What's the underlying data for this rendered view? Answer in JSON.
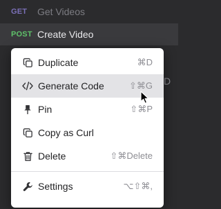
{
  "requests": [
    {
      "method": "GET",
      "name": "Get Videos"
    },
    {
      "method": "POST",
      "name": "Create Video"
    }
  ],
  "peek_text": "D",
  "context_menu": {
    "items": [
      {
        "label": "Duplicate",
        "shortcut": "⌘D",
        "icon": "duplicate-icon"
      },
      {
        "label": "Generate Code",
        "shortcut": "⇧⌘G",
        "icon": "code-icon"
      },
      {
        "label": "Pin",
        "shortcut": "⇧⌘P",
        "icon": "pin-icon"
      },
      {
        "label": "Copy as Curl",
        "shortcut": "",
        "icon": "copy-icon"
      },
      {
        "label": "Delete",
        "shortcut": "⇧⌘Delete",
        "icon": "trash-icon"
      },
      {
        "label": "Settings",
        "shortcut": "⌥⇧⌘,",
        "icon": "wrench-icon"
      }
    ],
    "highlighted_index": 1
  }
}
